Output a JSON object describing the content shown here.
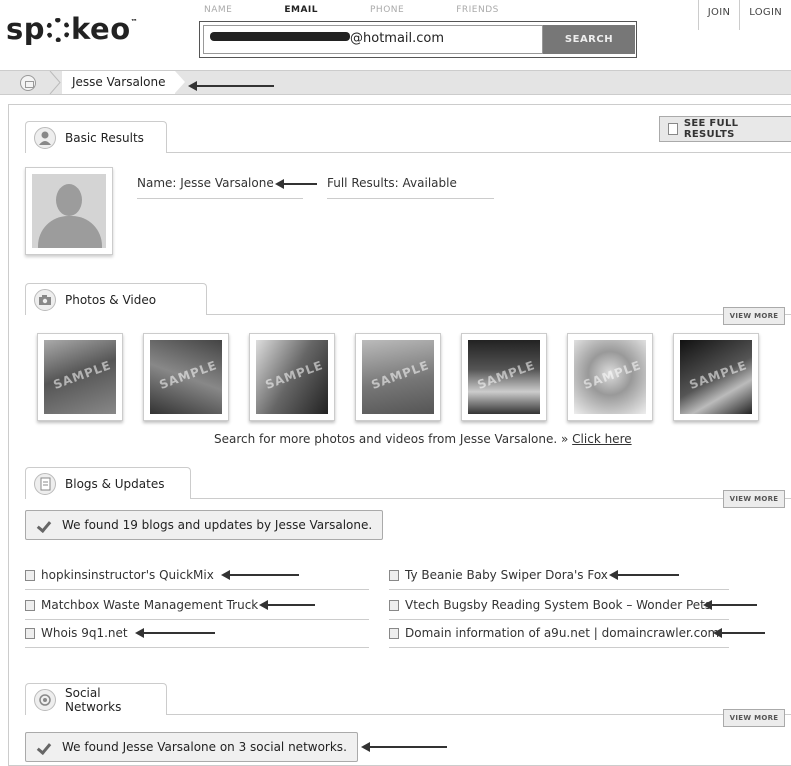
{
  "logo": {
    "text_before": "sp",
    "text_after": "keo",
    "trademark": "™"
  },
  "search": {
    "tabs": [
      "NAME",
      "EMAIL",
      "PHONE",
      "FRIENDS"
    ],
    "active_tab": "EMAIL",
    "value_suffix": "@hotmail.com",
    "button_label": "SEARCH"
  },
  "auth": {
    "join_label": "JOIN",
    "login_label": "LOGIN"
  },
  "breadcrumb": {
    "current": "Jesse Varsalone"
  },
  "basic_results": {
    "title": "Basic Results",
    "see_full_label": "SEE FULL RESULTS",
    "name_field": "Name: Jesse Varsalone",
    "full_results_field": "Full Results: Available"
  },
  "photos": {
    "title": "Photos & Video",
    "view_more_label": "VIEW MORE",
    "watermark": "SAMPLE",
    "caption": "Search for more photos and videos from Jesse Varsalone. »",
    "caption_link": "Click here"
  },
  "blogs": {
    "title": "Blogs & Updates",
    "view_more_label": "VIEW MORE",
    "found_text": "We found 19 blogs and updates by Jesse Varsalone.",
    "links": [
      "hopkinsinstructor's QuickMix",
      "Ty Beanie Baby Swiper Dora's Fox",
      "Matchbox Waste Management Truck",
      "Vtech Bugsby Reading System Book – Wonder Pets",
      "Whois 9q1.net",
      "Domain information of a9u.net | domaincrawler.com"
    ]
  },
  "social": {
    "title": "Social Networks",
    "view_more_label": "VIEW MORE",
    "found_text": "We found Jesse Varsalone on 3 social networks."
  },
  "icons": {
    "logo_o": "gear-icon",
    "home": "home-icon",
    "basic_results": "person-icon",
    "photos": "camera-icon",
    "blogs": "document-icon",
    "social": "network-icon",
    "check": "checkmark-icon",
    "arrow": "arrow-left-icon",
    "blog_link": "document-icon"
  },
  "colors": {
    "accent": "#777777",
    "background": "#ffffff",
    "crumb_bar": "#e4e4e4"
  }
}
